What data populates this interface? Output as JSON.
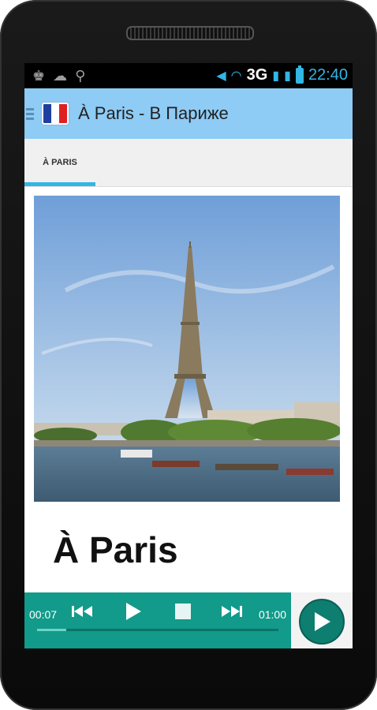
{
  "status_bar": {
    "left_icons": [
      "chess-king-icon",
      "android-icon",
      "usb-icon"
    ],
    "network": "3G",
    "time": "22:40"
  },
  "app_bar": {
    "title": "À Paris - В Париже",
    "flag_colors": [
      "#1f3fa0",
      "#ffffff",
      "#e02020"
    ]
  },
  "tabs": [
    {
      "label": "À PARIS",
      "selected": true
    }
  ],
  "card": {
    "image_description_icon": "eiffel-tower-photo",
    "word": "À Paris"
  },
  "player": {
    "elapsed": "00:07",
    "duration": "01:00",
    "progress_fraction": 0.12,
    "controls": [
      "previous-icon",
      "play-icon",
      "stop-icon",
      "next-icon"
    ]
  },
  "colors": {
    "accent_blue": "#33b5e5",
    "app_bar": "#8ecbf5",
    "player_teal": "#129a8a"
  }
}
